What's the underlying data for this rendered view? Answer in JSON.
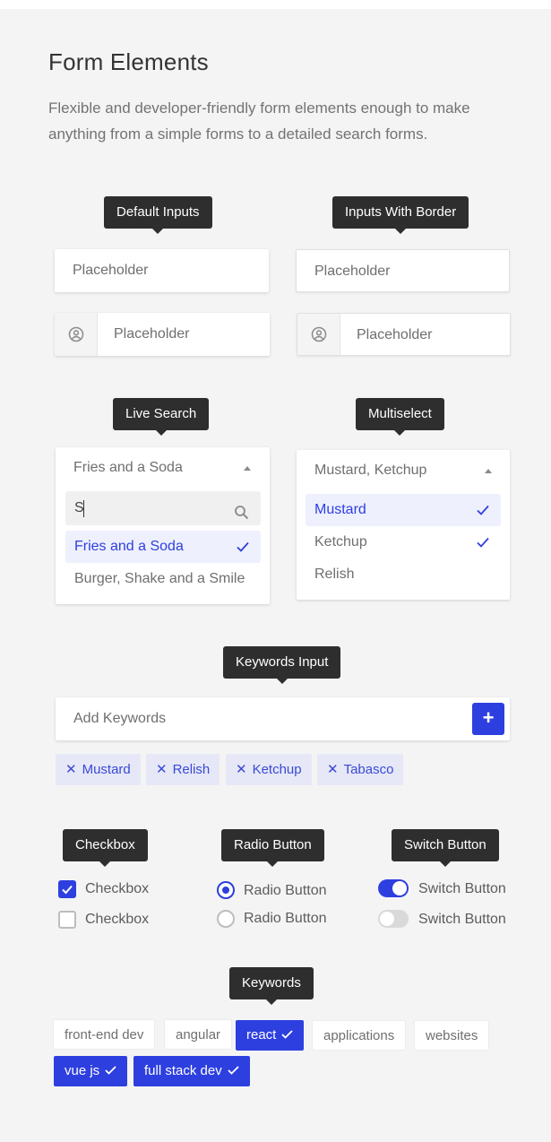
{
  "header": {
    "title": "Form Elements",
    "description": "Flexible and developer-friendly form elements enough to make anything from a simple forms to a detailed search forms."
  },
  "tooltips": {
    "default_inputs": "Default Inputs",
    "inputs_with_border": "Inputs With Border",
    "live_search": "Live Search",
    "multiselect": "Multiselect",
    "keywords_input": "Keywords Input",
    "checkbox": "Checkbox",
    "radio_button": "Radio Button",
    "switch_button": "Switch Button",
    "keywords": "Keywords"
  },
  "inputs": {
    "placeholder": "Placeholder"
  },
  "live_search": {
    "selected": "Fries and a Soda",
    "query": "S",
    "options": [
      {
        "label": "Fries and a Soda",
        "selected": true
      },
      {
        "label": "Burger, Shake and a Smile",
        "selected": false
      }
    ]
  },
  "multiselect": {
    "selected": "Mustard, Ketchup",
    "options": [
      {
        "label": "Mustard",
        "checked": true
      },
      {
        "label": "Ketchup",
        "checked": true
      },
      {
        "label": "Relish",
        "checked": false
      }
    ]
  },
  "keywords_input": {
    "placeholder": "Add Keywords",
    "add_symbol": "+",
    "tags": [
      "Mustard",
      "Relish",
      "Ketchup",
      "Tabasco"
    ],
    "remove_symbol": "✕"
  },
  "checkboxes": [
    {
      "label": "Checkbox",
      "checked": true
    },
    {
      "label": "Checkbox",
      "checked": false
    }
  ],
  "radios": [
    {
      "label": "Radio Button",
      "selected": true
    },
    {
      "label": "Radio Button",
      "selected": false
    }
  ],
  "switches": [
    {
      "label": "Switch Button",
      "on": true
    },
    {
      "label": "Switch Button",
      "on": false
    }
  ],
  "keywords": [
    {
      "label": "front-end dev",
      "active": false
    },
    {
      "label": "angular",
      "active": false
    },
    {
      "label": "react",
      "active": true
    },
    {
      "label": "applications",
      "active": false
    },
    {
      "label": "websites",
      "active": false
    },
    {
      "label": "vue js",
      "active": true
    },
    {
      "label": "full stack dev",
      "active": true
    }
  ],
  "colors": {
    "accent": "#2e3fe0",
    "tooltip_bg": "#2e2e2e",
    "page_bg": "#f4f4f4",
    "tag_bg": "#e6e8f7"
  },
  "icons": {
    "user": "user-circle-icon",
    "search": "search-icon",
    "check": "check-icon",
    "caret": "caret-up-icon",
    "close": "close-icon",
    "plus": "plus-icon"
  }
}
